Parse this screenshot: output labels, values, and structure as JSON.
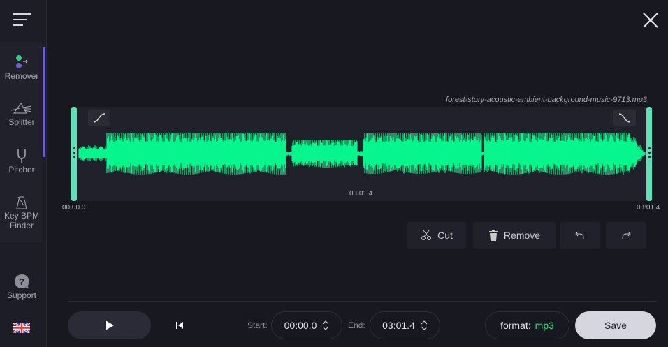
{
  "sidebar": {
    "items": [
      {
        "label": "Remover",
        "icon": "remover-icon"
      },
      {
        "label": "Splitter",
        "icon": "prism-icon"
      },
      {
        "label": "Pitcher",
        "icon": "tuning-fork-icon"
      },
      {
        "label": "Key BPM Finder",
        "icon": "metronome-icon"
      }
    ],
    "support": "Support",
    "language": "en-GB"
  },
  "editor": {
    "filename": "forest-story-acoustic-ambient-background-music-9713.mp3",
    "duration": "03:01.4",
    "time_start": "00:00.0",
    "time_end": "03:01.4"
  },
  "actions": {
    "cut": "Cut",
    "remove": "Remove"
  },
  "controls": {
    "start_label": "Start:",
    "start_value": "00:00.0",
    "end_label": "End:",
    "end_value": "03:01.4",
    "format_label": "format:",
    "format_value": "mp3",
    "save": "Save"
  },
  "colors": {
    "wave": "#06f58c",
    "handle": "#5fe0b9",
    "accent": "#6a5fd0",
    "format": "#2fe07f"
  }
}
